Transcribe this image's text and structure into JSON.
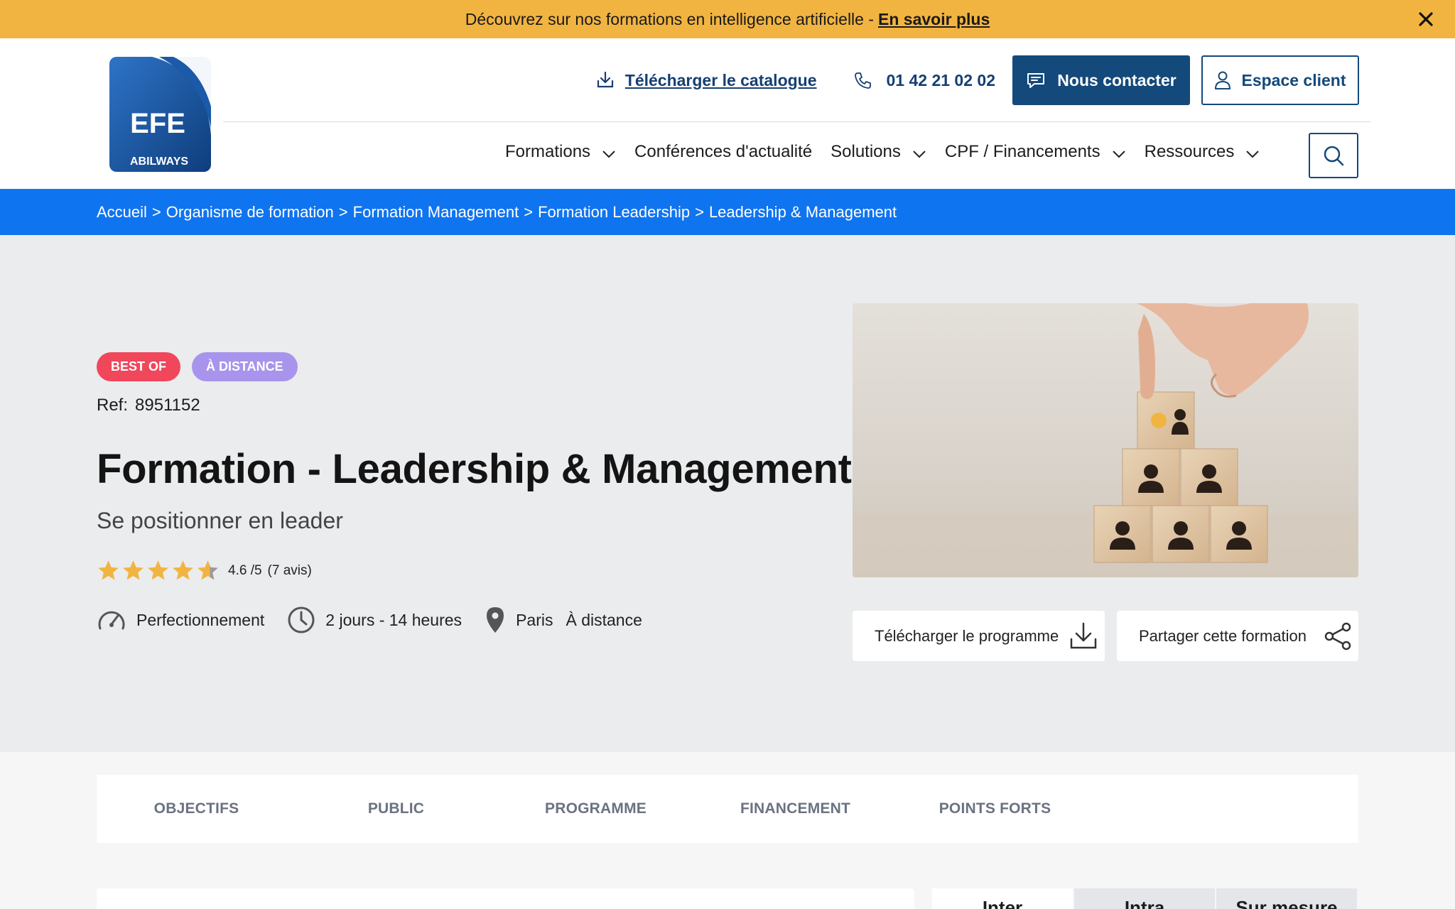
{
  "promo": {
    "text": "Découvrez sur nos formations en intelligence artificielle -",
    "link": "En savoir plus"
  },
  "brand": {
    "logo_main": "EFE",
    "logo_sub": "ABILWAYS"
  },
  "topbar": {
    "catalog": "Télécharger le catalogue",
    "phone": "01 42 21 02 02",
    "contact": "Nous contacter",
    "client": "Espace client"
  },
  "nav": {
    "items": [
      {
        "label": "Formations",
        "dropdown": true
      },
      {
        "label": "Conférences d'actualité",
        "dropdown": false
      },
      {
        "label": "Solutions",
        "dropdown": true
      },
      {
        "label": "CPF / Financements",
        "dropdown": true
      },
      {
        "label": "Ressources",
        "dropdown": true
      }
    ]
  },
  "breadcrumb": [
    "Accueil",
    "Organisme de formation",
    "Formation Management",
    "Formation Leadership",
    "Leadership & Management"
  ],
  "breadcrumb_sep": ">",
  "hero": {
    "badges": [
      "Best of",
      "À distance"
    ],
    "ref_label": "Ref:",
    "ref_value": "8951152",
    "title": "Formation - Leadership & Management",
    "subtitle": "Se positionner en leader",
    "rating": {
      "value": 4.6,
      "stars_max": 5,
      "score_text": "4.6 /5",
      "reviews": "(7 avis)"
    },
    "level": "Perfectionnement",
    "duration": "2 jours - 14 heures",
    "location": "Paris",
    "location_extra": "À distance",
    "download": "Télécharger le programme",
    "share": "Partager cette formation"
  },
  "tabs": [
    "Objectifs",
    "Public",
    "Programme",
    "Financement",
    "Points forts"
  ],
  "offer_tabs": [
    "Inter",
    "Intra",
    "Sur mesure"
  ],
  "colors": {
    "promo": "#f2b441",
    "primary": "#14497b",
    "breadcrumb": "#0f74f0",
    "badge_best": "#f0475b",
    "badge_distance": "#a894ec",
    "star": "#f2b441"
  }
}
